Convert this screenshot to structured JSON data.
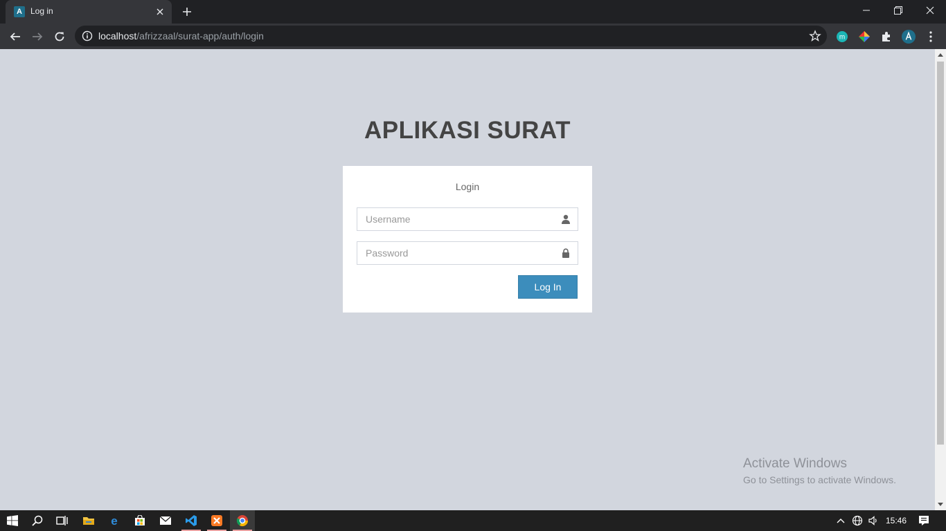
{
  "browser": {
    "tab": {
      "title": "Log in",
      "favicon": "A"
    },
    "url": {
      "host": "localhost",
      "path": "/afrizzaal/surat-app/auth/login"
    },
    "icons": {
      "back": "arrow-left-icon",
      "forward": "arrow-right-icon",
      "reload": "reload-icon",
      "info": "info-icon",
      "star": "star-icon",
      "extensions": [
        "m-extension-icon",
        "color-extension-icon",
        "puzzle-icon",
        "profile-avatar-icon"
      ],
      "menu": "kebab-menu-icon"
    }
  },
  "page": {
    "logo": "APLIKASI SURAT",
    "login_msg": "Login",
    "username": {
      "placeholder": "Username",
      "value": ""
    },
    "password": {
      "placeholder": "Password",
      "value": ""
    },
    "submit_label": "Log In",
    "colors": {
      "background": "#d2d6de",
      "button": "#3c8dbc"
    }
  },
  "watermark": {
    "title": "Activate Windows",
    "subtitle": "Go to Settings to activate Windows."
  },
  "taskbar": {
    "clock": "15:46",
    "apps": [
      "start-icon",
      "search-icon",
      "task-view-icon",
      "file-explorer-icon",
      "edge-icon",
      "store-icon",
      "mail-icon",
      "vscode-icon",
      "xampp-icon",
      "chrome-icon"
    ]
  }
}
